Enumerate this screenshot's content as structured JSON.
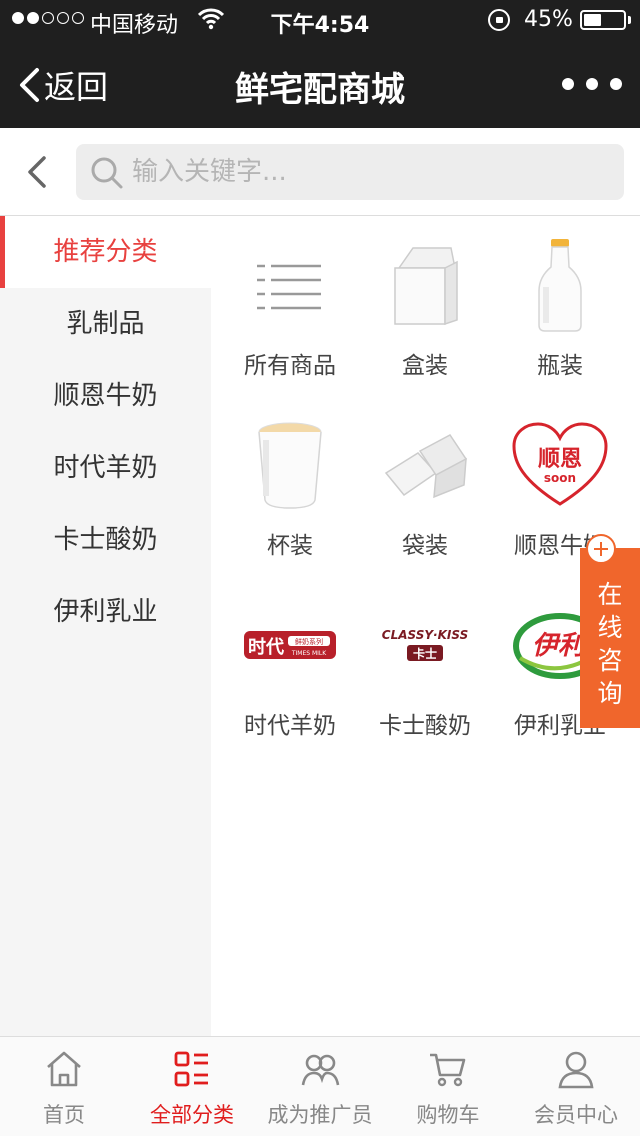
{
  "status_bar": {
    "carrier": "中国移动",
    "time": "下午4:54",
    "battery": "45%",
    "battery_level": 0.45,
    "signal_bars": 2
  },
  "nav": {
    "back_label": "返回",
    "title": "鲜宅配商城"
  },
  "search": {
    "placeholder": "输入关键字..."
  },
  "categories": [
    {
      "label": "推荐分类",
      "active": true
    },
    {
      "label": "乳制品",
      "active": false
    },
    {
      "label": "顺恩牛奶",
      "active": false
    },
    {
      "label": "时代羊奶",
      "active": false
    },
    {
      "label": "卡士酸奶",
      "active": false
    },
    {
      "label": "伊利乳业",
      "active": false
    }
  ],
  "grid_items": [
    {
      "label": "所有商品",
      "icon": "list-icon"
    },
    {
      "label": "盒装",
      "icon": "milk-carton-icon"
    },
    {
      "label": "瓶装",
      "icon": "milk-bottle-icon"
    },
    {
      "label": "杯装",
      "icon": "milk-cup-icon"
    },
    {
      "label": "袋装",
      "icon": "milk-bag-icon"
    },
    {
      "label": "顺恩牛奶",
      "icon": "shunen-logo",
      "logo_text": "顺恩",
      "logo_sub": "soon"
    },
    {
      "label": "时代羊奶",
      "icon": "shidai-logo",
      "logo_text": "时代",
      "logo_sub": "鲜奶系列",
      "logo_sub2": "TIMES MILK"
    },
    {
      "label": "卡士酸奶",
      "icon": "classykiss-logo",
      "logo_text": "CLASSY·KISS",
      "logo_sub": "卡士"
    },
    {
      "label": "伊利乳业",
      "icon": "yili-logo",
      "logo_text": "伊利"
    }
  ],
  "consult": {
    "label": "在线咨询"
  },
  "tabs": [
    {
      "label": "首页",
      "icon": "home-icon",
      "active": false
    },
    {
      "label": "全部分类",
      "icon": "category-icon",
      "active": true
    },
    {
      "label": "成为推广员",
      "icon": "promoter-icon",
      "active": false
    },
    {
      "label": "购物车",
      "icon": "cart-icon",
      "active": false
    },
    {
      "label": "会员中心",
      "icon": "member-icon",
      "active": false
    }
  ],
  "colors": {
    "accent": "#e8413f",
    "tab_active": "#e01d1d",
    "consult": "#f0662c",
    "nav_bg": "#1f1f1f"
  }
}
